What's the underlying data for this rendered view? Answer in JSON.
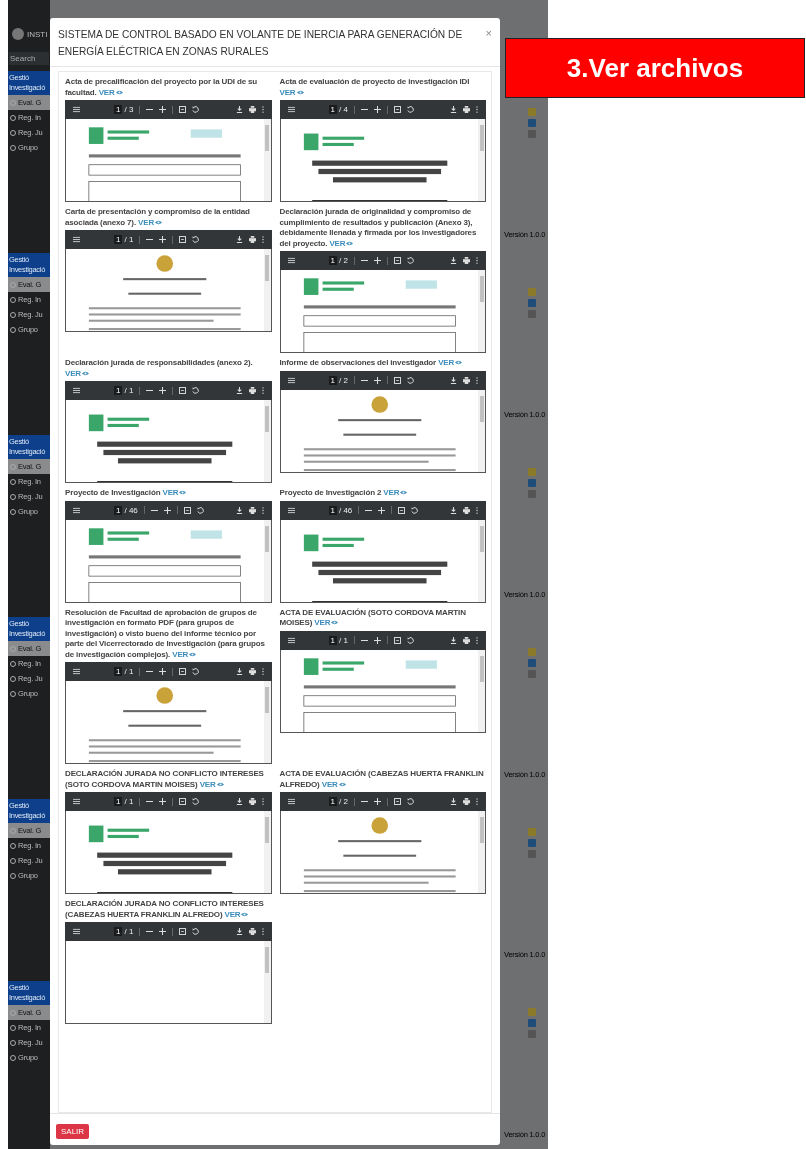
{
  "sidebar": {
    "user": "INSTI",
    "search": {
      "placeholder": "Search"
    },
    "groups": [
      {
        "title": "Gestió",
        "subtitle": "Investigació",
        "items": [
          {
            "label": "Eval. G",
            "selected": true
          },
          {
            "label": "Reg. In",
            "selected": false
          },
          {
            "label": "Reg. Ju",
            "selected": false
          },
          {
            "label": "Grupo",
            "selected": false
          }
        ]
      },
      {
        "title": "Gestió",
        "subtitle": "Investigació",
        "items": [
          {
            "label": "Eval. G",
            "selected": true
          },
          {
            "label": "Reg. In",
            "selected": false
          },
          {
            "label": "Reg. Ju",
            "selected": false
          },
          {
            "label": "Grupo",
            "selected": false
          }
        ]
      },
      {
        "title": "Gestió",
        "subtitle": "Investigació",
        "items": [
          {
            "label": "Eval. G",
            "selected": true
          },
          {
            "label": "Reg. In",
            "selected": false
          },
          {
            "label": "Reg. Ju",
            "selected": false
          },
          {
            "label": "Grupo",
            "selected": false
          }
        ]
      },
      {
        "title": "Gestió",
        "subtitle": "Investigació",
        "items": [
          {
            "label": "Eval. G",
            "selected": true
          },
          {
            "label": "Reg. In",
            "selected": false
          },
          {
            "label": "Reg. Ju",
            "selected": false
          },
          {
            "label": "Grupo",
            "selected": false
          }
        ]
      },
      {
        "title": "Gestió",
        "subtitle": "Investigació",
        "items": [
          {
            "label": "Eval. G",
            "selected": true
          },
          {
            "label": "Reg. In",
            "selected": false
          },
          {
            "label": "Reg. Ju",
            "selected": false
          },
          {
            "label": "Grupo",
            "selected": false
          }
        ]
      },
      {
        "title": "Gestió",
        "subtitle": "Investigació",
        "items": [
          {
            "label": "Eval. G",
            "selected": true
          },
          {
            "label": "Reg. In",
            "selected": false
          },
          {
            "label": "Reg. Ju",
            "selected": false
          },
          {
            "label": "Grupo",
            "selected": false
          }
        ]
      }
    ]
  },
  "background_panels": [
    {
      "version": "Versión 1.0.0"
    },
    {
      "version": "Versión 1.0.0"
    },
    {
      "version": "Versión 1.0.0"
    },
    {
      "version": "Versión 1.0.0"
    },
    {
      "version": "Versión 1.0.0"
    },
    {
      "version": "Versión 1.0.0"
    }
  ],
  "callout": "3.Ver archivos",
  "modal": {
    "title": "SISTEMA DE CONTROL BASADO EN VOLANTE DE INERCIA PARA GENERACIÓN DE ENERGÍA ELÉCTRICA EN ZONAS RURALES",
    "close": "×",
    "documents": [
      {
        "label": "Acta de precalificación del proyecto por la UDI de su facultad.",
        "link": "VER",
        "page": "1",
        "page_total": "/ 3",
        "kind": "document"
      },
      {
        "label": "Acta de evaluación de proyecto de investigación IDI",
        "link": "VER",
        "page": "1",
        "page_total": "/ 4",
        "kind": "document"
      },
      {
        "label": "Carta de presentación y compromiso de la entidad asociada (anexo 7).",
        "link": "VER",
        "page": "1",
        "page_total": "/ 1",
        "kind": "document"
      },
      {
        "label": "Declaración jurada de originalidad y compromiso de cumplimiento de resultados y publicación (Anexo 3), debidamente llenada y firmada por los investigadores del proyecto.",
        "link": "VER",
        "page": "1",
        "page_total": "/ 2",
        "kind": "document"
      },
      {
        "label": "Declaración jurada de responsabilidades (anexo 2).",
        "link": "VER",
        "page": "1",
        "page_total": "/ 1",
        "kind": "document"
      },
      {
        "label": "Informe de observaciones del investigador",
        "link": "VER",
        "page": "1",
        "page_total": "/ 2",
        "kind": "document"
      },
      {
        "label": "Proyecto de Investigación",
        "link": "VER",
        "page": "1",
        "page_total": "/ 46",
        "kind": "document"
      },
      {
        "label": "Proyecto de Investigación 2",
        "link": "VER",
        "page": "1",
        "page_total": "/ 46",
        "kind": "document"
      },
      {
        "label": "Resolución de Facultad de aprobación de grupos de investigación en formato PDF (para grupos de investigación) o visto bueno del informe técnico por parte del Vicerrectorado de Investigación (para grupos de investigación complejos).",
        "link": "VER",
        "page": "1",
        "page_total": "/ 1",
        "kind": "document"
      },
      {
        "label": "ACTA DE EVALUACIÓN (SOTO CORDOVA MARTIN MOISES)",
        "link": "VER",
        "page": "1",
        "page_total": "/ 1",
        "kind": "document"
      },
      {
        "label": "DECLARACIÓN JURADA NO CONFLICTO INTERESES (SOTO CORDOVA MARTIN MOISES)",
        "link": "VER",
        "page": "1",
        "page_total": "/ 1",
        "kind": "document"
      },
      {
        "label": "ACTA DE EVALUACIÓN (CABEZAS HUERTA FRANKLIN ALFREDO)",
        "link": "VER",
        "page": "1",
        "page_total": "/ 2",
        "kind": "document"
      },
      {
        "label": "DECLARACIÓN JURADA NO CONFLICTO INTERESES (CABEZAS HUERTA FRANKLIN ALFREDO)",
        "link": "VER",
        "page": "1",
        "page_total": "/ 1",
        "kind": "blank"
      }
    ],
    "footer_button": "SALIR"
  }
}
